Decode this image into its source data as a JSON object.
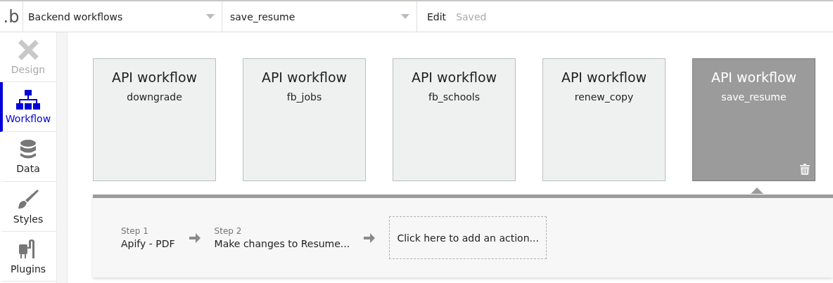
{
  "top_bar": {
    "logo": ".b",
    "dropdowns": [
      {
        "value": "Backend workflows"
      },
      {
        "value": "save_resume"
      }
    ],
    "edit_button": "Edit",
    "save_status": "Saved"
  },
  "sidebar": {
    "items": [
      {
        "label": "Design",
        "kind": "design",
        "selected": false,
        "disabled": true
      },
      {
        "label": "Workflow",
        "kind": "workflow",
        "selected": true,
        "disabled": false
      },
      {
        "label": "Data",
        "kind": "data",
        "selected": false,
        "disabled": false
      },
      {
        "label": "Styles",
        "kind": "styles",
        "selected": false,
        "disabled": false
      },
      {
        "label": "Plugins",
        "kind": "plugins",
        "selected": false,
        "disabled": false
      }
    ]
  },
  "workflows": [
    {
      "title": "API workflow",
      "name": "downgrade",
      "selected": false
    },
    {
      "title": "API workflow",
      "name": "fb_jobs",
      "selected": false
    },
    {
      "title": "API workflow",
      "name": "fb_schools",
      "selected": false
    },
    {
      "title": "API workflow",
      "name": "renew_copy",
      "selected": false
    },
    {
      "title": "API workflow",
      "name": "save_resume",
      "selected": true
    }
  ],
  "steps": [
    {
      "label": "Step 1",
      "action": "Apify - PDF"
    },
    {
      "label": "Step 2",
      "action": "Make changes to Resume..."
    }
  ],
  "add_action": "Click here to add an action..."
}
